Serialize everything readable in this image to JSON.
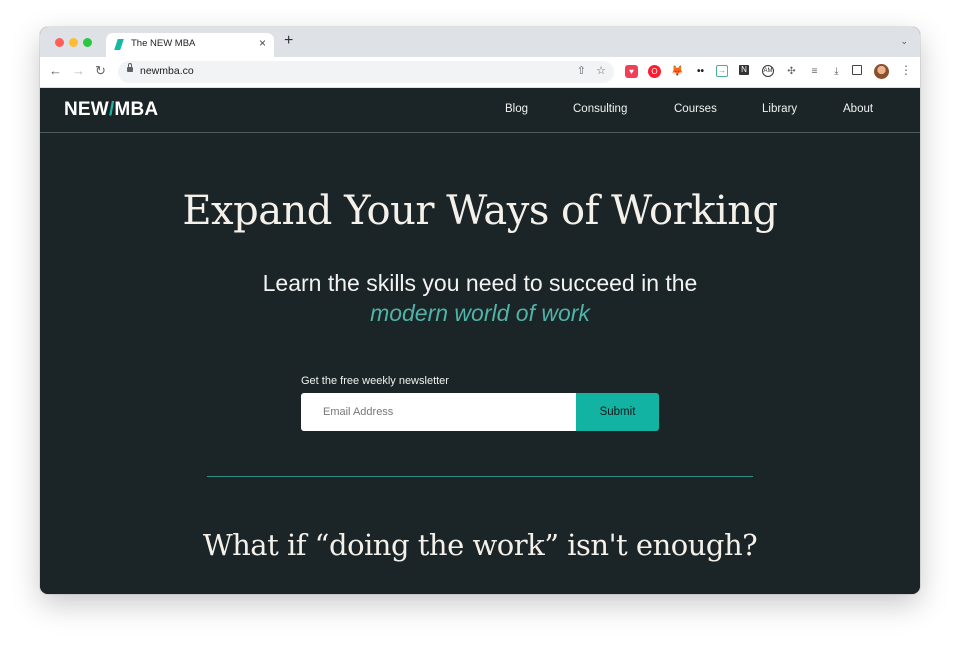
{
  "browser": {
    "tab_title": "The NEW MBA",
    "tab_close": "×",
    "new_tab": "+",
    "tab_menu": "⌄",
    "url": "newmba.co",
    "nav": {
      "back": "←",
      "forward": "→",
      "reload": "↻"
    },
    "omnibox_icons": {
      "share": "⇧",
      "bookmark": "☆"
    },
    "extensions": [
      "pocket-icon",
      "opera-icon",
      "metamask-icon",
      "dots-extension-icon",
      "arrow-box-icon",
      "notion-icon",
      "circle-extension-icon",
      "puzzle-icon",
      "reading-list-icon",
      "download-icon",
      "side-panel-icon"
    ],
    "extension_glyphs": {
      "pocket": "♥",
      "opera": "O",
      "fox": "🦊",
      "dots": "••",
      "box": "→",
      "n": "N",
      "circle": "AM",
      "puzzle": "✣",
      "queue": "≡",
      "download": "⤓"
    },
    "menu": "⋮"
  },
  "site": {
    "logo_left": "NEW",
    "logo_slash": "/",
    "logo_right": "MBA",
    "nav": [
      {
        "label": "Blog"
      },
      {
        "label": "Consulting"
      },
      {
        "label": "Courses"
      },
      {
        "label": "Library"
      },
      {
        "label": "About"
      }
    ],
    "accent_color": "#14b8a6",
    "background_color": "#1b2426"
  },
  "hero": {
    "title": "Expand Your Ways of Working",
    "subtitle": "Learn the skills you need to succeed in the",
    "subtitle_accent": "modern world of work"
  },
  "newsletter": {
    "label": "Get the free weekly newsletter",
    "email_placeholder": "Email Address",
    "email_value": "",
    "submit_label": "Submit"
  },
  "section": {
    "title": "What if “doing the work” isn't enough?"
  }
}
